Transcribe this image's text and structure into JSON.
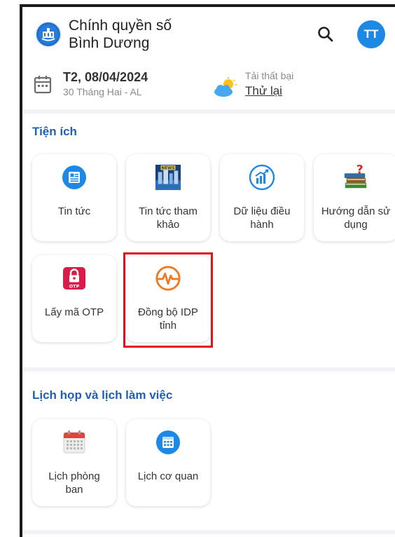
{
  "header": {
    "title_line1": "Chính quyền số",
    "title_line2": "Bình Dương",
    "avatar_initials": "TT",
    "logo_icon": "city-emblem-icon",
    "search_icon": "search-icon"
  },
  "date": {
    "main": "T2, 08/04/2024",
    "lunar": "30 Tháng Hai - AL",
    "icon": "calendar-icon"
  },
  "weather": {
    "status": "Tải thất bại",
    "retry_label": "Thử lại",
    "icon": "partly-cloudy-icon"
  },
  "utilities": {
    "title": "Tiện ích",
    "items": [
      {
        "label_l1": "Tin tức",
        "label_l2": "",
        "icon": "news-icon"
      },
      {
        "label_l1": "Tin tức tham",
        "label_l2": "khảo",
        "icon": "news-thumbnail-icon"
      },
      {
        "label_l1": "Dữ liệu điều",
        "label_l2": "hành",
        "icon": "analytics-chart-icon"
      },
      {
        "label_l1": "Hướng dẫn sử",
        "label_l2": "dụng",
        "icon": "books-question-icon"
      },
      {
        "label_l1": "Lấy mã OTP",
        "label_l2": "",
        "icon": "otp-lock-icon",
        "badge": "OTP"
      },
      {
        "label_l1": "Đồng bộ IDP",
        "label_l2": "tỉnh",
        "icon": "heartbeat-sync-icon"
      }
    ]
  },
  "meetings": {
    "title": "Lịch họp và lịch làm việc",
    "items": [
      {
        "label_l1": "Lịch phòng",
        "label_l2": "ban",
        "icon": "calendar-grid-icon"
      },
      {
        "label_l1": "Lịch cơ quan",
        "label_l2": "",
        "icon": "calendar-app-icon"
      }
    ]
  },
  "colors": {
    "accent": "#1f5fb4",
    "avatar": "#1e88e5",
    "highlight_border": "#e0121c",
    "sync_icon": "#f07a22",
    "otp_icon": "#d81b48"
  }
}
